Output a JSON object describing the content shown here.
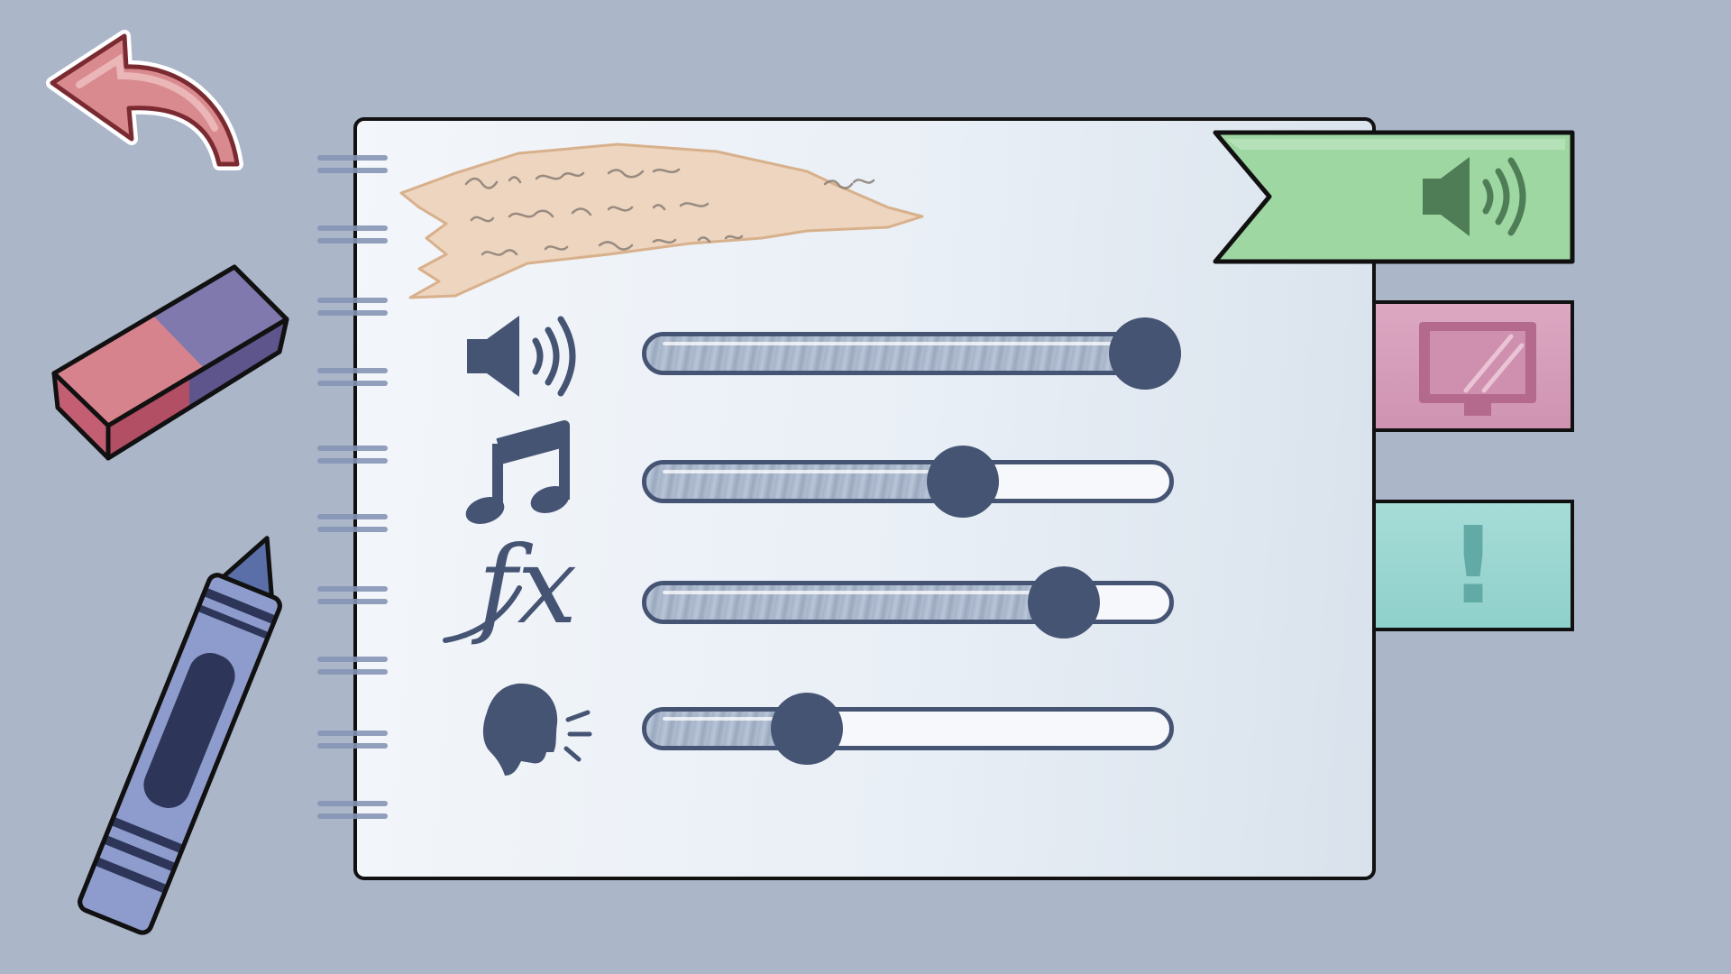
{
  "colors": {
    "background": "#abb6c9",
    "ink": "#465474",
    "sound_tab": "#9fd7a3",
    "display_tab": "#d7a2bd",
    "info_tab": "#9dd8d2",
    "back_arrow": "#d98a8e"
  },
  "tabs": [
    {
      "name": "sound",
      "icon": "speaker-icon",
      "active": true
    },
    {
      "name": "display",
      "icon": "monitor-icon",
      "active": false
    },
    {
      "name": "info",
      "icon": "exclamation-icon",
      "active": false
    }
  ],
  "sliders": [
    {
      "name": "master-volume",
      "icon": "speaker-icon",
      "level": 1.0
    },
    {
      "name": "music-volume",
      "icon": "music-note-icon",
      "level": 0.62
    },
    {
      "name": "sfx-volume",
      "icon": "fx-icon",
      "level": 0.84
    },
    {
      "name": "voice-volume",
      "icon": "voice-icon",
      "level": 0.28
    }
  ],
  "fx_label": "fx",
  "info_label": "!",
  "decorations": [
    "back-arrow-icon",
    "eraser-icon",
    "crayon-icon",
    "scribble-note-icon"
  ]
}
